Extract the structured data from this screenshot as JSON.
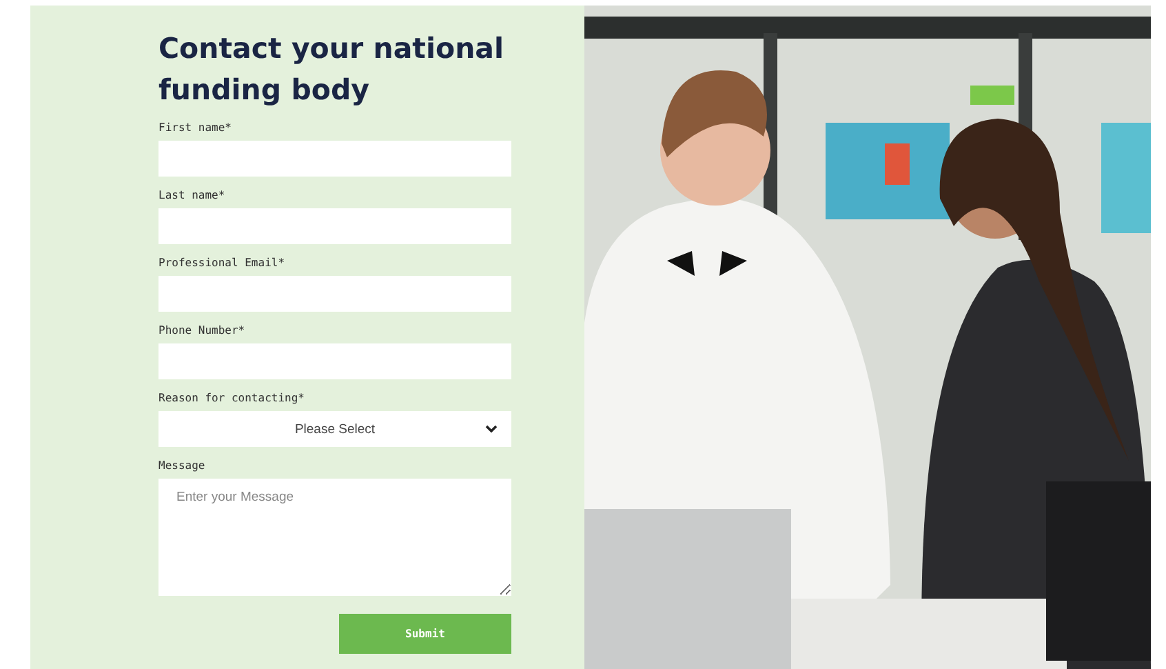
{
  "title": "Contact your national funding body",
  "fields": [
    {
      "kind": "text",
      "label": "First name*"
    },
    {
      "kind": "text",
      "label": "Last name*"
    },
    {
      "kind": "text",
      "label": "Professional Email*"
    },
    {
      "kind": "text",
      "label": "Phone Number*"
    },
    {
      "kind": "select",
      "label": "Reason for contacting*",
      "value": "Please Select"
    },
    {
      "kind": "textarea",
      "label": "Message",
      "placeholder": "Enter your Message"
    }
  ],
  "submit": "Submit"
}
